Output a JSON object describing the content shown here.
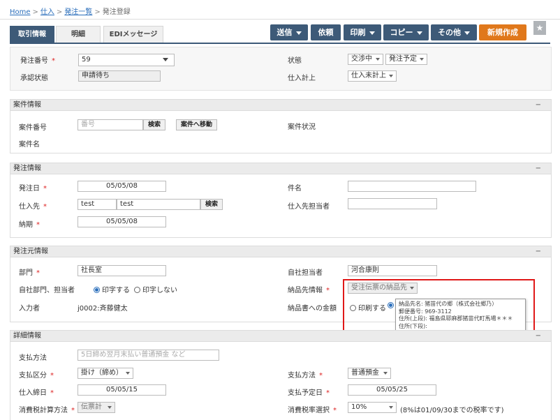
{
  "breadcrumb": {
    "home": "Home",
    "purchase": "仕入",
    "list": "発注一覧",
    "current": "発注登録"
  },
  "tabs": [
    "取引情報",
    "明細",
    "EDIメッセージ"
  ],
  "toolbar": {
    "send": "送信",
    "request": "依頼",
    "print": "印刷",
    "copy": "コピー",
    "other": "その他",
    "new": "新規作成"
  },
  "top": {
    "order_no_label": "発注番号",
    "order_no": "59",
    "approval_label": "承認状態",
    "approval_value": "申請待ち",
    "status_label": "状態",
    "status1": "交渉中",
    "status2": "発注予定",
    "purchase_label": "仕入計上",
    "purchase_value": "仕入未計上"
  },
  "case": {
    "title": "案件情報",
    "collapse": "−",
    "no_label": "案件番号",
    "no_placeholder": "番号",
    "search": "検索",
    "move": "案件へ移動",
    "status_label": "案件状況",
    "name_label": "案件名"
  },
  "order": {
    "title": "発注情報",
    "collapse": "−",
    "date_label": "発注日",
    "date": "05/05/08",
    "supplier_label": "仕入先",
    "supplier_code": "test",
    "supplier_name": "test",
    "search": "検索",
    "due_label": "納期",
    "due": "05/05/08",
    "subject_label": "件名",
    "contact_label": "仕入先担当者"
  },
  "source": {
    "title": "発注元情報",
    "collapse": "−",
    "dept_label": "部門",
    "dept": "社長室",
    "dept_staff_label": "自社部門、担当者",
    "print_yes": "印字する",
    "print_no": "印字しない",
    "entered_label": "入力者",
    "entered_value": "j0002:斉藤健太",
    "staff_label": "自社担当者",
    "staff": "河合康則",
    "delivery_label": "納品先情報",
    "delivery_value": "受注伝票の納品先",
    "amount_label": "納品書への金額",
    "amount_print": "印刷する"
  },
  "tooltip": {
    "line1": "納品先名: 猪苗代の郷（株式会社郷乃）",
    "line2": "郵便番号: 969-3112",
    "line3": "住所(上段): 福島県耶麻郡猪苗代町馬場＊＊＊",
    "line4": "住所(下段):"
  },
  "detail": {
    "title": "詳細情報",
    "collapse": "−",
    "pay_method_label": "支払方法",
    "pay_method_placeholder": "5日締め翌月末払い普通預金 など",
    "pay_div_label": "支払区分",
    "pay_div": "掛け（締め）",
    "pay_type_label": "支払方法",
    "pay_type": "普通預金",
    "close_label": "仕入締日",
    "close_date": "05/05/15",
    "pay_due_label": "支払予定日",
    "pay_due": "05/05/25",
    "tax_calc_label": "消費税計算方法",
    "tax_calc": "伝票計",
    "tax_rate_label": "消費税率選択",
    "tax_rate": "10%",
    "tax_note": "(8%は01/09/30までの税率です)"
  },
  "colors": {
    "navy": "#3d5a78",
    "orange": "#e0781b",
    "required": "#d22222",
    "highlight": "#e01818"
  }
}
